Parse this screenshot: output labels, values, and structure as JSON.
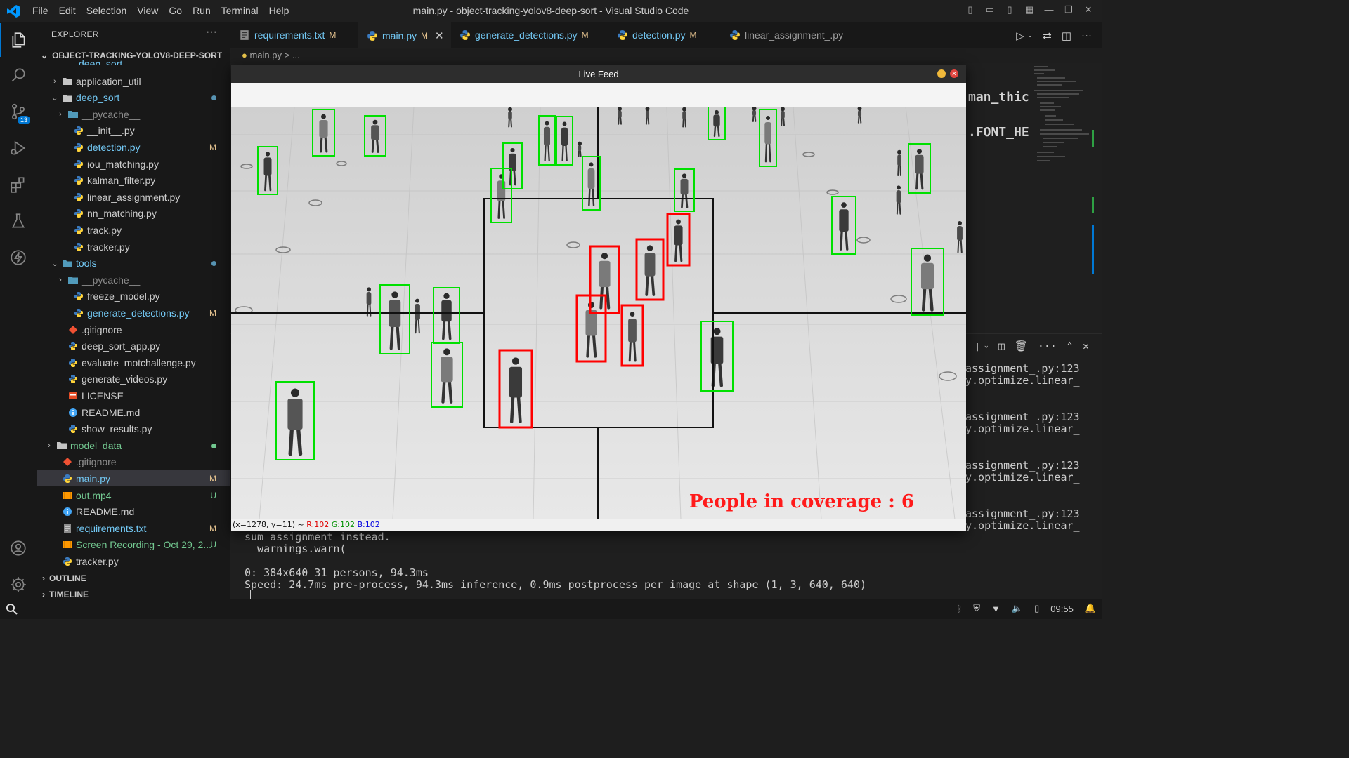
{
  "titlebar": {
    "menu": [
      "File",
      "Edit",
      "Selection",
      "View",
      "Go",
      "Run",
      "Terminal",
      "Help"
    ],
    "window_title": "main.py - object-tracking-yolov8-deep-sort - Visual Studio Code"
  },
  "activity": {
    "scm_badge": "13"
  },
  "sidebar": {
    "header": "EXPLORER",
    "project": "OBJECT-TRACKING-YOLOV8-DEEP-SORT",
    "cut_top_label": "deep_sort",
    "items": [
      {
        "label": "application_util",
        "type": "folder",
        "depth": 1,
        "open": false,
        "status": ""
      },
      {
        "label": "deep_sort",
        "type": "folder",
        "depth": 1,
        "open": true,
        "status": "dot",
        "color": "#73c9f5"
      },
      {
        "label": "__pycache__",
        "type": "folder-blue",
        "depth": 2,
        "open": false,
        "status": "",
        "dim": true
      },
      {
        "label": "__init__.py",
        "type": "py",
        "depth": 2,
        "status": ""
      },
      {
        "label": "detection.py",
        "type": "py",
        "depth": 2,
        "status": "M",
        "mod": true
      },
      {
        "label": "iou_matching.py",
        "type": "py",
        "depth": 2,
        "status": ""
      },
      {
        "label": "kalman_filter.py",
        "type": "py",
        "depth": 2,
        "status": ""
      },
      {
        "label": "linear_assignment.py",
        "type": "py",
        "depth": 2,
        "status": ""
      },
      {
        "label": "nn_matching.py",
        "type": "py",
        "depth": 2,
        "status": ""
      },
      {
        "label": "track.py",
        "type": "py",
        "depth": 2,
        "status": ""
      },
      {
        "label": "tracker.py",
        "type": "py",
        "depth": 2,
        "status": ""
      },
      {
        "label": "tools",
        "type": "folder-blue",
        "depth": 1,
        "open": true,
        "status": "dot",
        "color": "#73c9f5"
      },
      {
        "label": "__pycache__",
        "type": "folder-blue",
        "depth": 2,
        "open": false,
        "status": "",
        "dim": true
      },
      {
        "label": "freeze_model.py",
        "type": "py",
        "depth": 2,
        "status": ""
      },
      {
        "label": "generate_detections.py",
        "type": "py",
        "depth": 2,
        "status": "M",
        "mod": true
      },
      {
        "label": ".gitignore",
        "type": "git",
        "depth": 1,
        "status": ""
      },
      {
        "label": "deep_sort_app.py",
        "type": "py",
        "depth": 1,
        "status": ""
      },
      {
        "label": "evaluate_motchallenge.py",
        "type": "py",
        "depth": 1,
        "status": ""
      },
      {
        "label": "generate_videos.py",
        "type": "py",
        "depth": 1,
        "status": ""
      },
      {
        "label": "LICENSE",
        "type": "license",
        "depth": 1,
        "status": ""
      },
      {
        "label": "README.md",
        "type": "info",
        "depth": 1,
        "status": ""
      },
      {
        "label": "show_results.py",
        "type": "py",
        "depth": 1,
        "status": ""
      },
      {
        "label": "model_data",
        "type": "folder",
        "depth": 0,
        "open": false,
        "status": "dot-green",
        "untr": true
      },
      {
        "label": ".gitignore",
        "type": "git",
        "depth": 0,
        "status": "",
        "dim": true
      },
      {
        "label": "main.py",
        "type": "py",
        "depth": 0,
        "status": "M",
        "mod": true,
        "selected": true
      },
      {
        "label": "out.mp4",
        "type": "video",
        "depth": 0,
        "status": "U",
        "untr": true
      },
      {
        "label": "README.md",
        "type": "info",
        "depth": 0,
        "status": ""
      },
      {
        "label": "requirements.txt",
        "type": "txt",
        "depth": 0,
        "status": "M",
        "mod": true
      },
      {
        "label": "Screen Recording - Oct 29, 2...",
        "type": "video",
        "depth": 0,
        "status": "U",
        "untr": true
      },
      {
        "label": "tracker.py",
        "type": "py",
        "depth": 0,
        "status": ""
      }
    ],
    "outline": "OUTLINE",
    "timeline": "TIMELINE"
  },
  "tabs": [
    {
      "label": "requirements.txt",
      "status": "M",
      "icon": "txt"
    },
    {
      "label": "main.py",
      "status": "M",
      "icon": "py",
      "active": true
    },
    {
      "label": "generate_detections.py",
      "status": "M",
      "icon": "py"
    },
    {
      "label": "detection.py",
      "status": "M",
      "icon": "py"
    },
    {
      "label": "linear_assignment_.py",
      "status": "",
      "icon": "py"
    }
  ],
  "breadcrumb": "main.py > ...",
  "editor": {
    "code_line1": "man_thic",
    "code_line2": ".FONT_HE"
  },
  "terminal": {
    "right_lines": [
      "assignment_.py:123",
      "y.optimize.linear_",
      "assignment_.py:123",
      "y.optimize.linear_",
      "assignment_.py:123",
      "y.optimize.linear_",
      "assignment_.py:123",
      "y.optimize.linear_"
    ],
    "lines": [
      "sum_assignment instead.",
      "  warnings.warn(",
      "",
      "0: 384x640 31 persons, 94.3ms",
      "Speed: 24.7ms pre-process, 94.3ms inference, 0.9ms postprocess per image at shape (1, 3, 640, 640)"
    ]
  },
  "statusbar": {
    "time": "09:55"
  },
  "livefeed": {
    "title": "Live Feed",
    "count_text": "People in coverage : 6",
    "status_coord": "(x=1278, y=11) ~",
    "status_r": "R:102",
    "status_g": "G:102",
    "status_b": "B:102",
    "colors": {
      "inside": "#ff0000",
      "outside": "#00e000",
      "zone": "#111111"
    }
  }
}
